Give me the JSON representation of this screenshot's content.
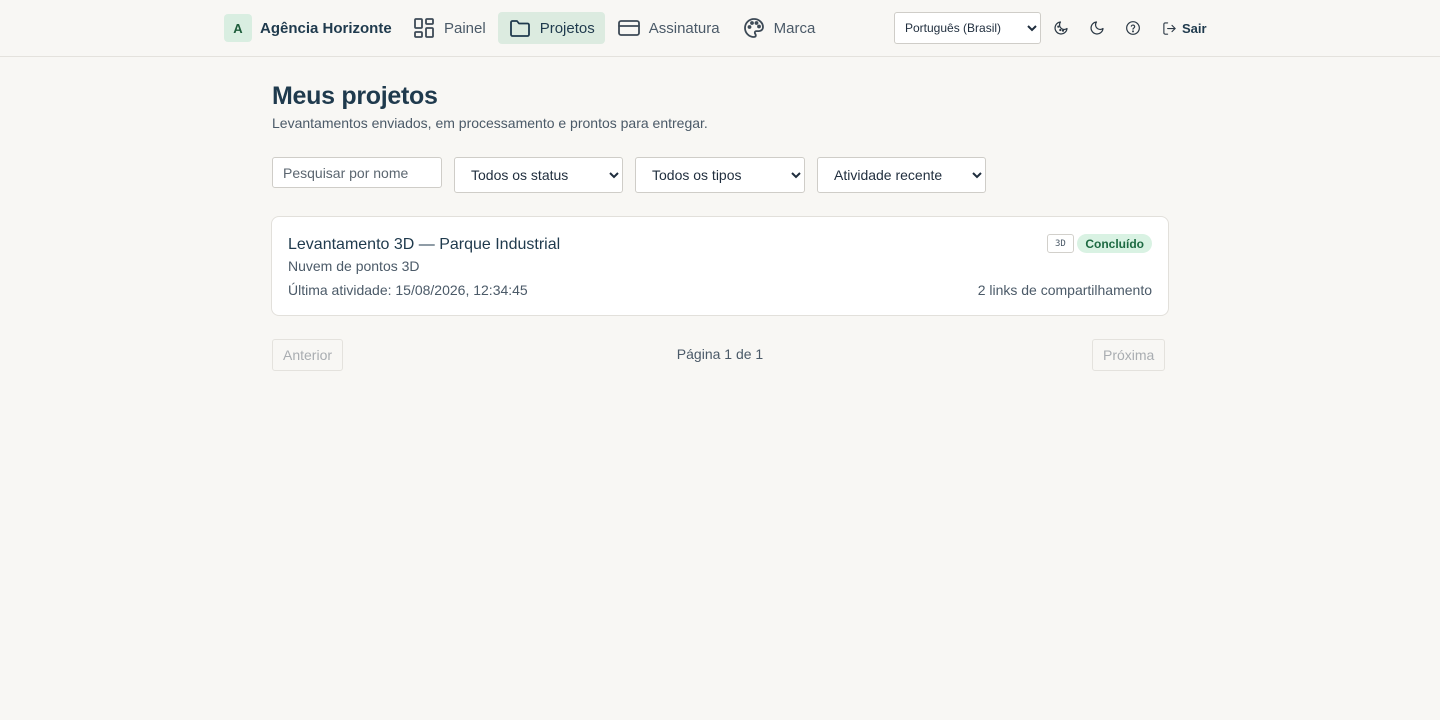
{
  "header": {
    "brand_initial": "A",
    "brand_name": "Agência Horizonte",
    "nav": [
      {
        "label": "Painel",
        "icon": "dashboard-icon",
        "active": false
      },
      {
        "label": "Projetos",
        "icon": "folder-icon",
        "active": true
      },
      {
        "label": "Assinatura",
        "icon": "credit-card-icon",
        "active": false
      },
      {
        "label": "Marca",
        "icon": "palette-icon",
        "active": false
      }
    ],
    "language": {
      "selected": "Português (Brasil)"
    },
    "icons": [
      "theme-auto-icon",
      "moon-icon",
      "help-icon"
    ],
    "logout_label": "Sair"
  },
  "main": {
    "title": "Meus projetos",
    "subtitle": "Levantamentos enviados, em processamento e prontos para entregar.",
    "filters": {
      "search_placeholder": "Pesquisar por nome",
      "status": "Todos os status",
      "type": "Todos os tipos",
      "sort": "Atividade recente"
    },
    "projects": [
      {
        "title": "Levantamento 3D — Parque Industrial",
        "type": "Nuvem de pontos 3D",
        "badge": "3D",
        "status": "Concluído",
        "last_activity": "Última atividade: 15/08/2026, 12:34:45",
        "share_links": "2 links de compartilhamento"
      }
    ],
    "pagination": {
      "previous": "Anterior",
      "info": "Página 1 de 1",
      "next": "Próxima"
    }
  },
  "colors": {
    "background": "#f8f7f4",
    "accent_active": "#dcebe0",
    "status_done_bg": "#d9f2e3",
    "status_done_text": "#1d6a42",
    "heading": "#1f3a4d"
  }
}
